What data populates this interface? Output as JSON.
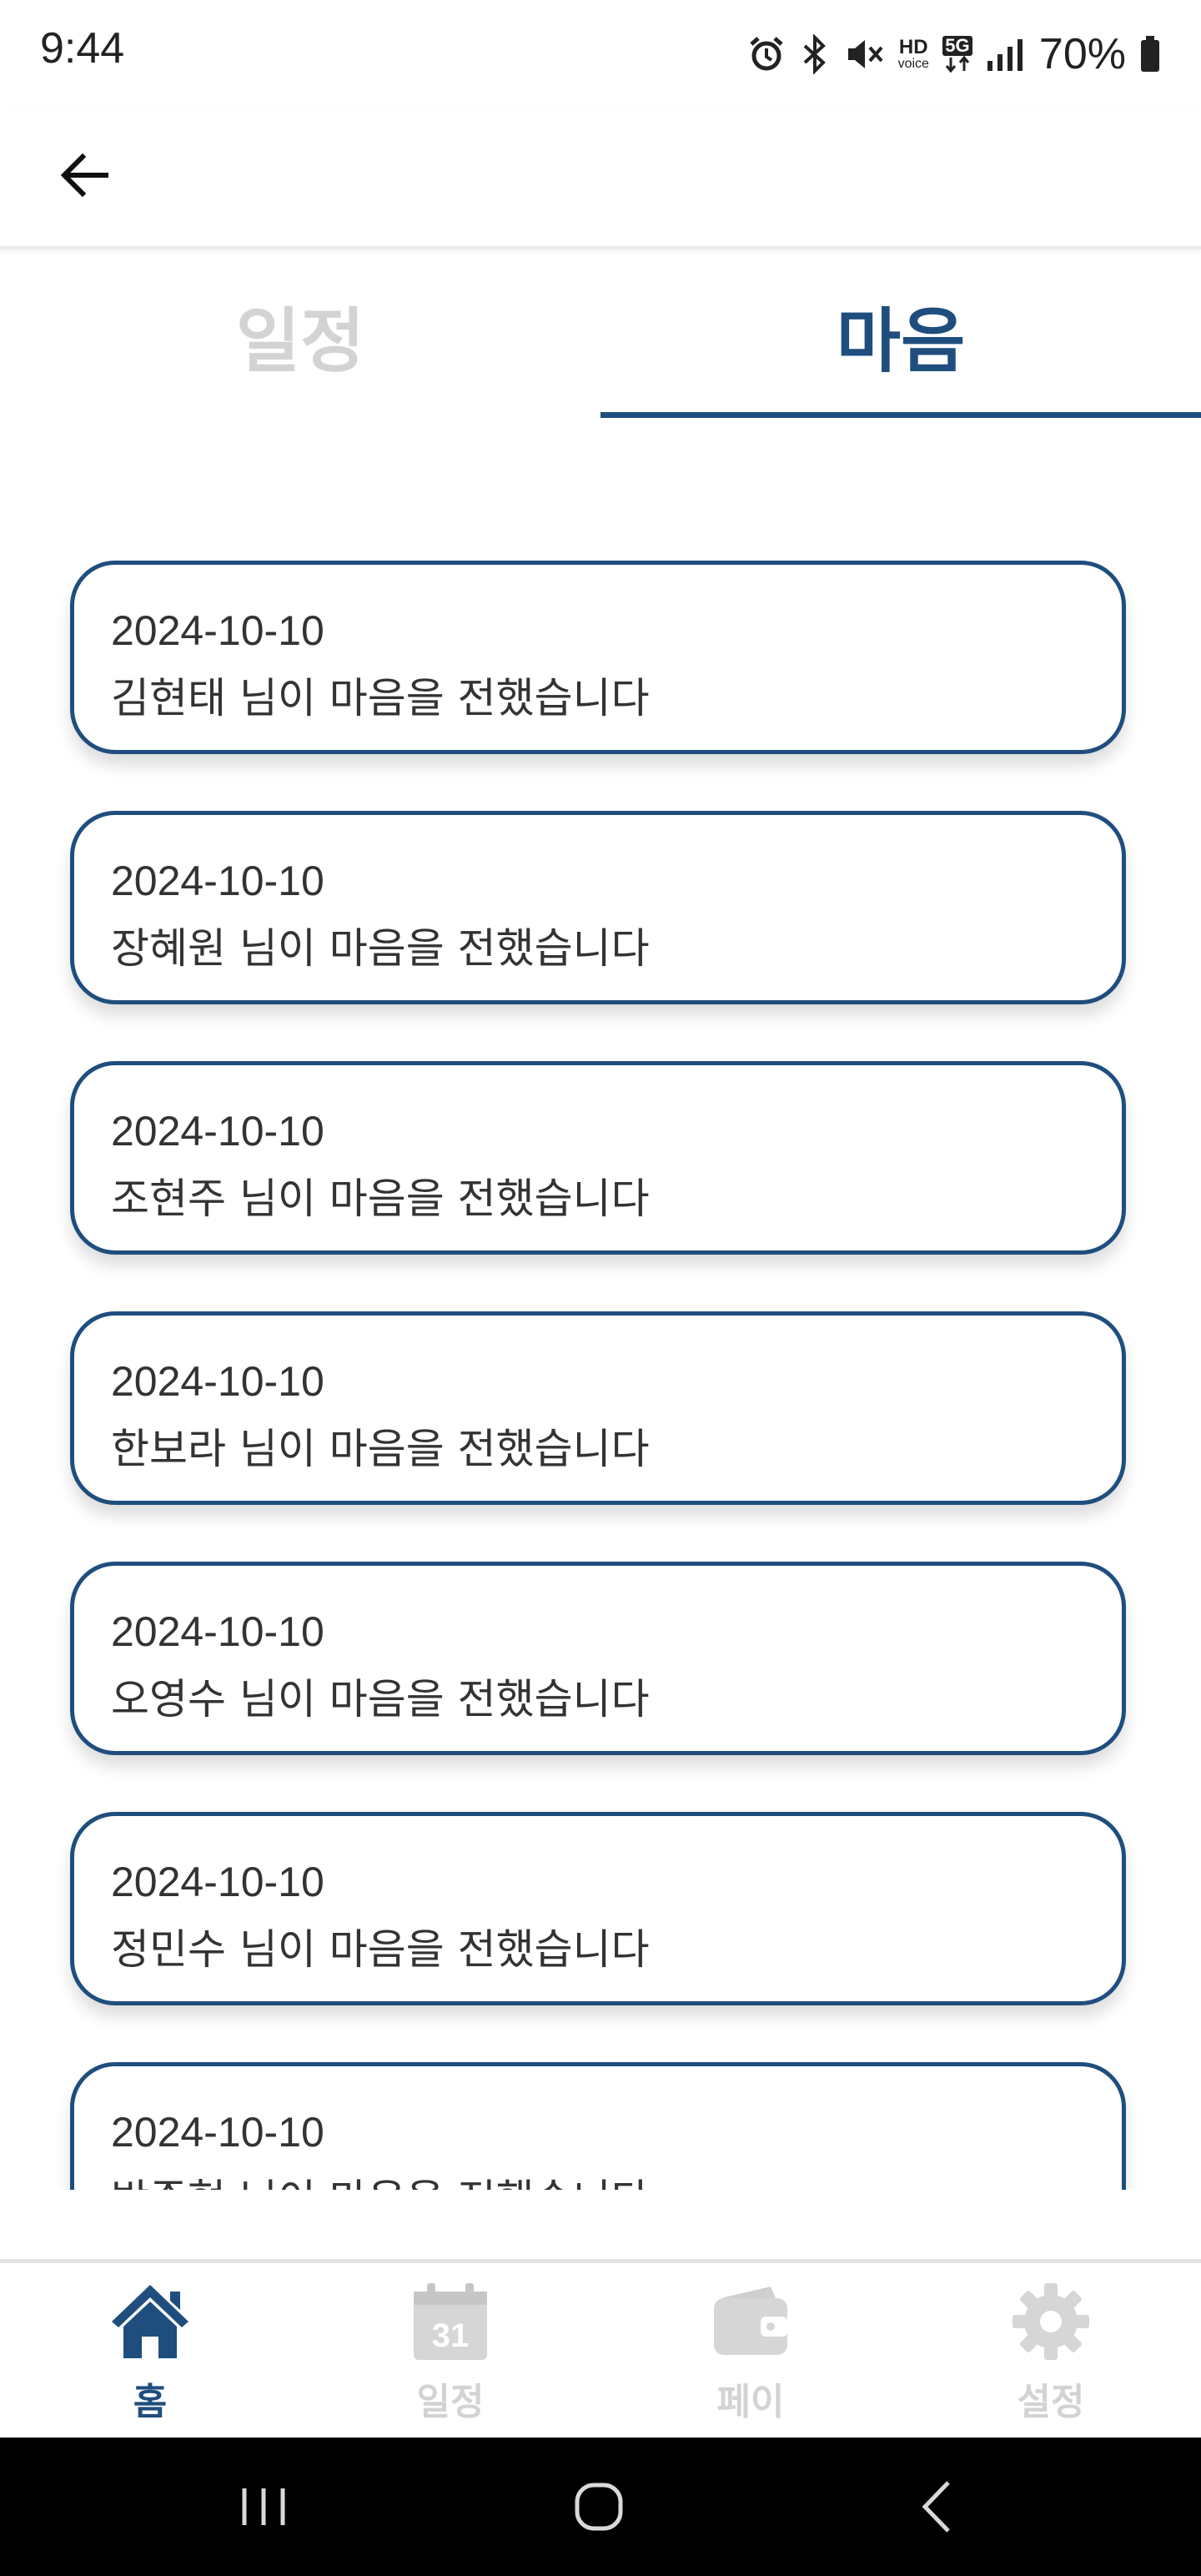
{
  "status_bar": {
    "time": "9:44",
    "battery_percent": "70%",
    "icons": [
      "alarm-icon",
      "bluetooth-icon",
      "mute-icon",
      "hd-voice-icon",
      "5g-icon",
      "signal-icon",
      "battery-icon"
    ],
    "hd_text": "HD",
    "voice_text": "voice",
    "network_text": "5G"
  },
  "app_bar": {
    "back_icon": "arrow-left-icon"
  },
  "tabs": [
    {
      "label": "일정",
      "active": false
    },
    {
      "label": "마음",
      "active": true
    }
  ],
  "items": [
    {
      "date": "2024-10-10",
      "message": "김현태 님이 마음을 전했습니다"
    },
    {
      "date": "2024-10-10",
      "message": "장혜원 님이 마음을 전했습니다"
    },
    {
      "date": "2024-10-10",
      "message": "조현주 님이 마음을 전했습니다"
    },
    {
      "date": "2024-10-10",
      "message": "한보라 님이 마음을 전했습니다"
    },
    {
      "date": "2024-10-10",
      "message": "오영수 님이 마음을 전했습니다"
    },
    {
      "date": "2024-10-10",
      "message": "정민수 님이 마음을 전했습니다"
    },
    {
      "date": "2024-10-10",
      "message": "박준형 님이 마음을 전했습니다"
    }
  ],
  "bottom_nav": [
    {
      "label": "홈",
      "icon": "home-icon",
      "active": true
    },
    {
      "label": "일정",
      "icon": "calendar-icon",
      "active": false,
      "calendar_day": "31"
    },
    {
      "label": "페이",
      "icon": "wallet-icon",
      "active": false
    },
    {
      "label": "설정",
      "icon": "gear-icon",
      "active": false
    }
  ],
  "system_nav": [
    "recents-icon",
    "home-circle-icon",
    "back-chevron-icon"
  ],
  "colors": {
    "primary": "#1f4e7e",
    "inactive": "#d3d3d3",
    "text": "#333333"
  }
}
